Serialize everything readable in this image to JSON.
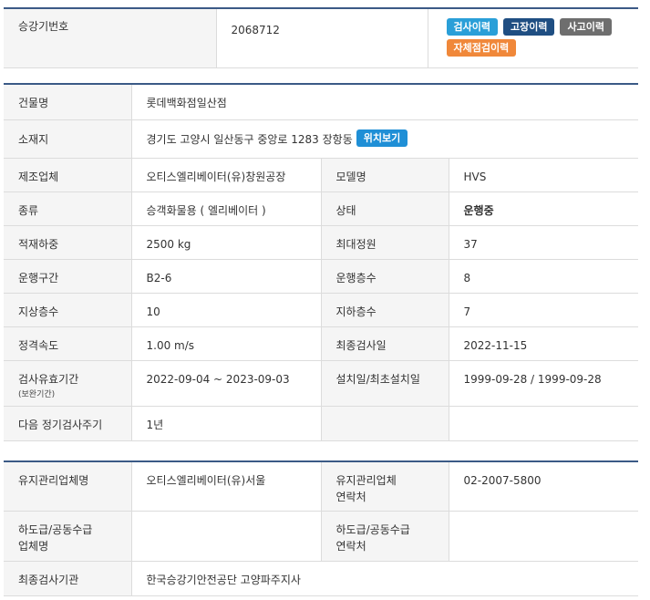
{
  "header": {
    "elevator_no_label": "승강기번호",
    "elevator_no": "2068712",
    "buttons": {
      "inspection_history": "검사이력",
      "failure_history": "고장이력",
      "accident_history": "사고이력",
      "self_inspection_history": "자체점검이력"
    },
    "colors": {
      "rule": "#3b5a86",
      "blue": "#2a9fd8",
      "navy": "#1f4e82",
      "gray": "#6e6e6e",
      "orange": "#f0883a"
    }
  },
  "info": {
    "building_label": "건물명",
    "building": "롯데백화점일산점",
    "address_label": "소재지",
    "address": "경기도 고양시 일산동구 중앙로 1283 장항동",
    "location_button": "위치보기",
    "manufacturer_label": "제조업체",
    "manufacturer": "오티스엘리베이터(유)창원공장",
    "model_label": "모델명",
    "model": "HVS",
    "type_label": "종류",
    "type": "승객화물용 ( 엘리베이터 )",
    "status_label": "상태",
    "status": "운행중",
    "load_label": "적재하중",
    "load": "2500 kg",
    "capacity_label": "최대정원",
    "capacity": "37",
    "section_label": "운행구간",
    "section": "B2-6",
    "floors_label": "운행층수",
    "floors": "8",
    "above_label": "지상층수",
    "above": "10",
    "below_label": "지하층수",
    "below": "7",
    "speed_label": "정격속도",
    "speed": "1.00 m/s",
    "last_inspection_label": "최종검사일",
    "last_inspection": "2022-11-15",
    "validity_label": "검사유효기간",
    "validity_sub": "(보완기간)",
    "validity": "2022-09-04 ~ 2023-09-03",
    "install_label": "설치일/최초설치일",
    "install": "1999-09-28 / 1999-09-28",
    "cycle_label": "다음 정기검사주기",
    "cycle": "1년"
  },
  "maintenance": {
    "company_label": "유지관리업체명",
    "company": "오티스엘리베이터(유)서울",
    "contact_label_1": "유지관리업체",
    "contact_label_2": "연락처",
    "contact": "02-2007-5800",
    "sub_label_1": "하도급/공동수급",
    "sub_label_2": "업체명",
    "sub": "",
    "sub_contact_label_1": "하도급/공동수급",
    "sub_contact_label_2": "연락처",
    "sub_contact": "",
    "agency_label": "최종검사기관",
    "agency": "한국승강기안전공단 고양파주지사"
  }
}
